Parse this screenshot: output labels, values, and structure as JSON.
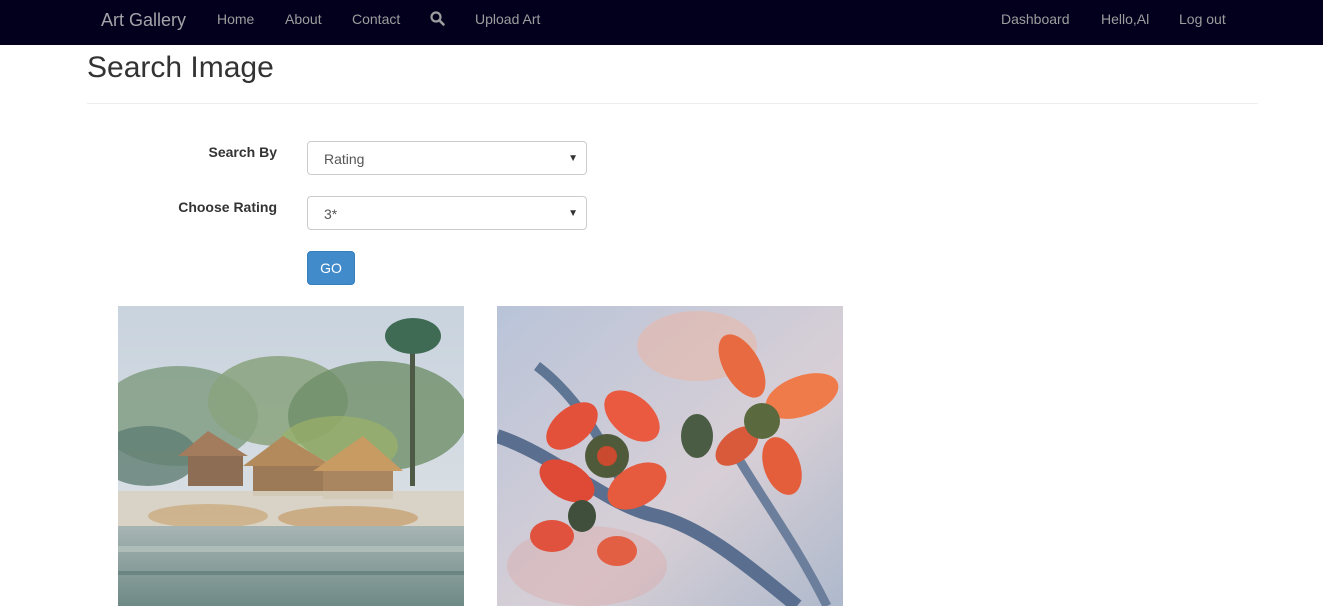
{
  "navbar": {
    "brand": "Art Gallery",
    "left_links": [
      "Home",
      "About",
      "Contact",
      "Upload Art"
    ],
    "search_icon": "search-icon",
    "right_links": [
      "Dashboard",
      "Hello,Al",
      "Log out"
    ]
  },
  "page": {
    "title": "Search Image"
  },
  "form": {
    "search_by": {
      "label": "Search By",
      "selected": "Rating"
    },
    "rating": {
      "label": "Choose Rating",
      "selected": "3*"
    },
    "submit_label": "GO"
  },
  "results": [
    {
      "subject": "watercolor landscape with huts and pond"
    },
    {
      "subject": "watercolor red flowers on branch"
    }
  ],
  "colors": {
    "navbar_bg": "#03001e",
    "nav_text": "#9d9d9d",
    "button_primary": "#428bca"
  }
}
